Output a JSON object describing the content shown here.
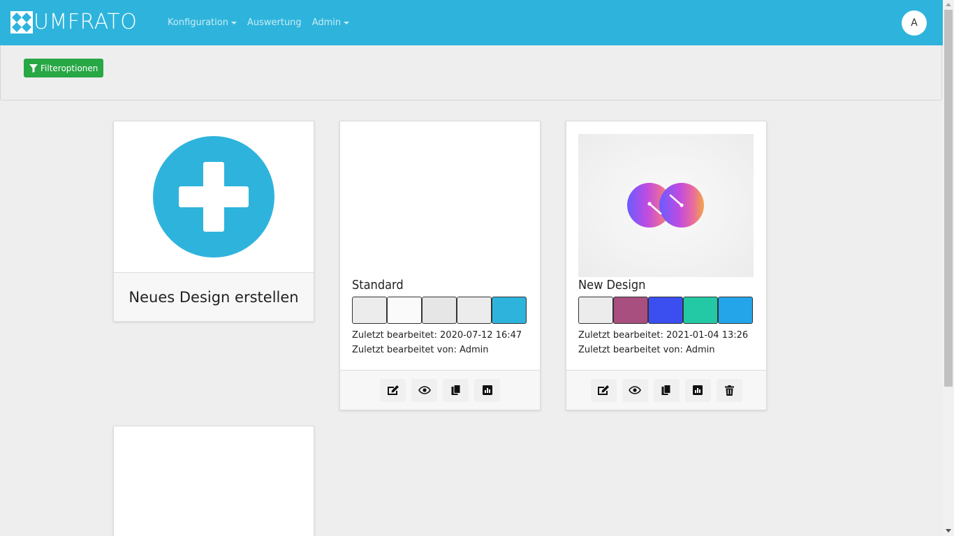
{
  "brand": {
    "name": "UMFRATO",
    "logo_icon": "diamond-grid-logo"
  },
  "nav": {
    "items": [
      {
        "label": "Konfiguration",
        "dropdown": true
      },
      {
        "label": "Auswertung",
        "dropdown": false
      },
      {
        "label": "Admin",
        "dropdown": true
      }
    ]
  },
  "user": {
    "avatar_initial": "A"
  },
  "filter": {
    "button_label": "Filteroptionen",
    "icon": "filter-icon"
  },
  "new_design": {
    "label": "Neues Design erstellen",
    "icon": "plus-icon"
  },
  "designs": [
    {
      "title": "Standard",
      "colors": [
        "#ececec",
        "#fafafa",
        "#e6e6e6",
        "#ececec",
        "#2eb4dc"
      ],
      "last_edited": "Zuletzt bearbeitet: 2020-07-12 16:47",
      "last_edited_by": "Zuletzt bearbeitet von: Admin",
      "has_image": false,
      "actions": [
        "edit-icon",
        "eye-icon",
        "copy-icon",
        "chart-icon"
      ]
    },
    {
      "title": "New Design",
      "colors": [
        "#ececec",
        "#a84f7f",
        "#3b4ff0",
        "#22c9a4",
        "#24a5ea"
      ],
      "last_edited": "Zuletzt bearbeitet: 2021-01-04 13:26",
      "last_edited_by": "Zuletzt bearbeitet von: Admin",
      "has_image": true,
      "image_icon": "infinity-logo",
      "actions": [
        "edit-icon",
        "eye-icon",
        "copy-icon",
        "chart-icon",
        "trash-icon"
      ]
    }
  ]
}
